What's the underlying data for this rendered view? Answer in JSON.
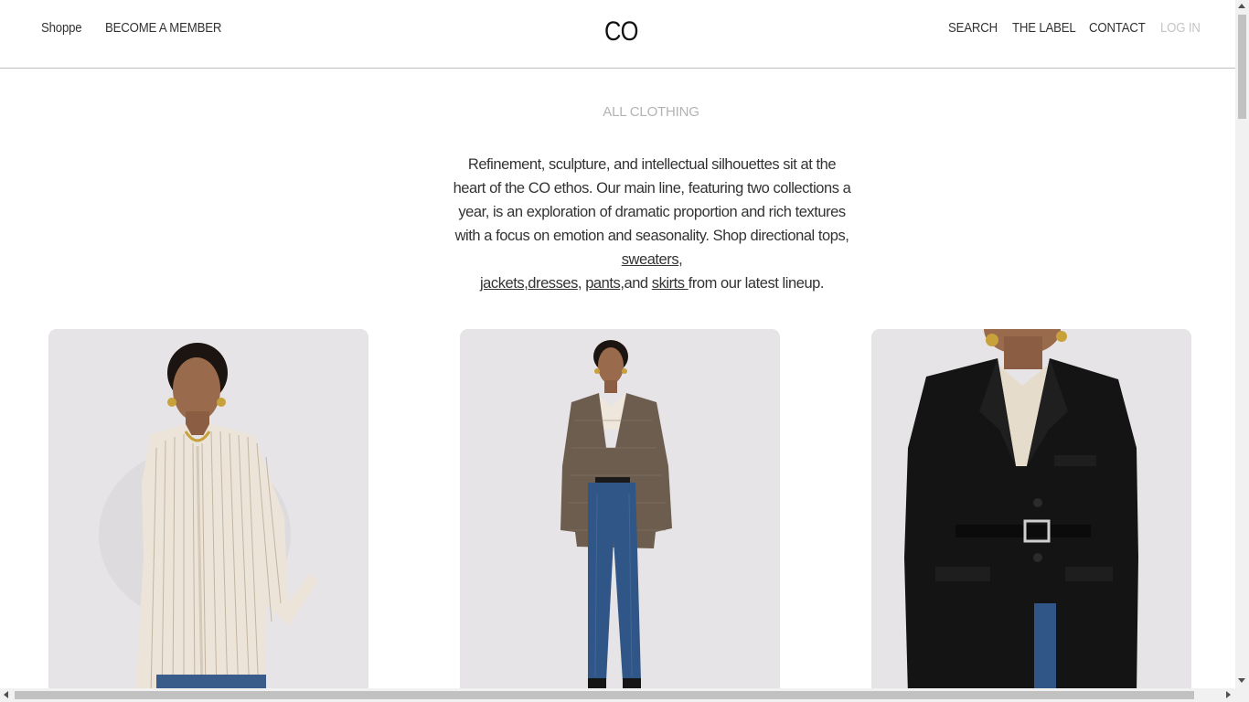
{
  "header": {
    "nav_left": [
      "Shoppe",
      "BECOME A MEMBER"
    ],
    "logo": "CO",
    "nav_right": [
      "SEARCH",
      "THE LABEL",
      "CONTACT"
    ],
    "login": "LOG IN"
  },
  "main": {
    "title": "ALL CLOTHING",
    "intro": {
      "text": "Refinement, sculpture, and intellectual silhouettes sit at the heart of the CO ethos. Our main line, featuring two collections a year, is an exploration of dramatic proportion and rich textures with a focus on emotion and seasonality. Shop directional tops, ",
      "link_sweaters": "sweaters",
      "comma1": ",",
      "link_jackets": "jackets",
      "comma2": ",",
      "link_dresses": "dresses",
      "comma3": ", ",
      "link_pants": "pants",
      "and": ",and ",
      "link_skirts": "skirts ",
      "tail": "from our latest lineup."
    }
  },
  "products": [
    {
      "image": "striped-shirt-model-image"
    },
    {
      "image": "tweed-blazer-jeans-model-image"
    },
    {
      "image": "black-belted-blazer-model-image"
    }
  ],
  "colors": {
    "card_bg": "#e6e4e6",
    "muted_text": "#b3b3b3",
    "border": "#bdbdbd"
  }
}
